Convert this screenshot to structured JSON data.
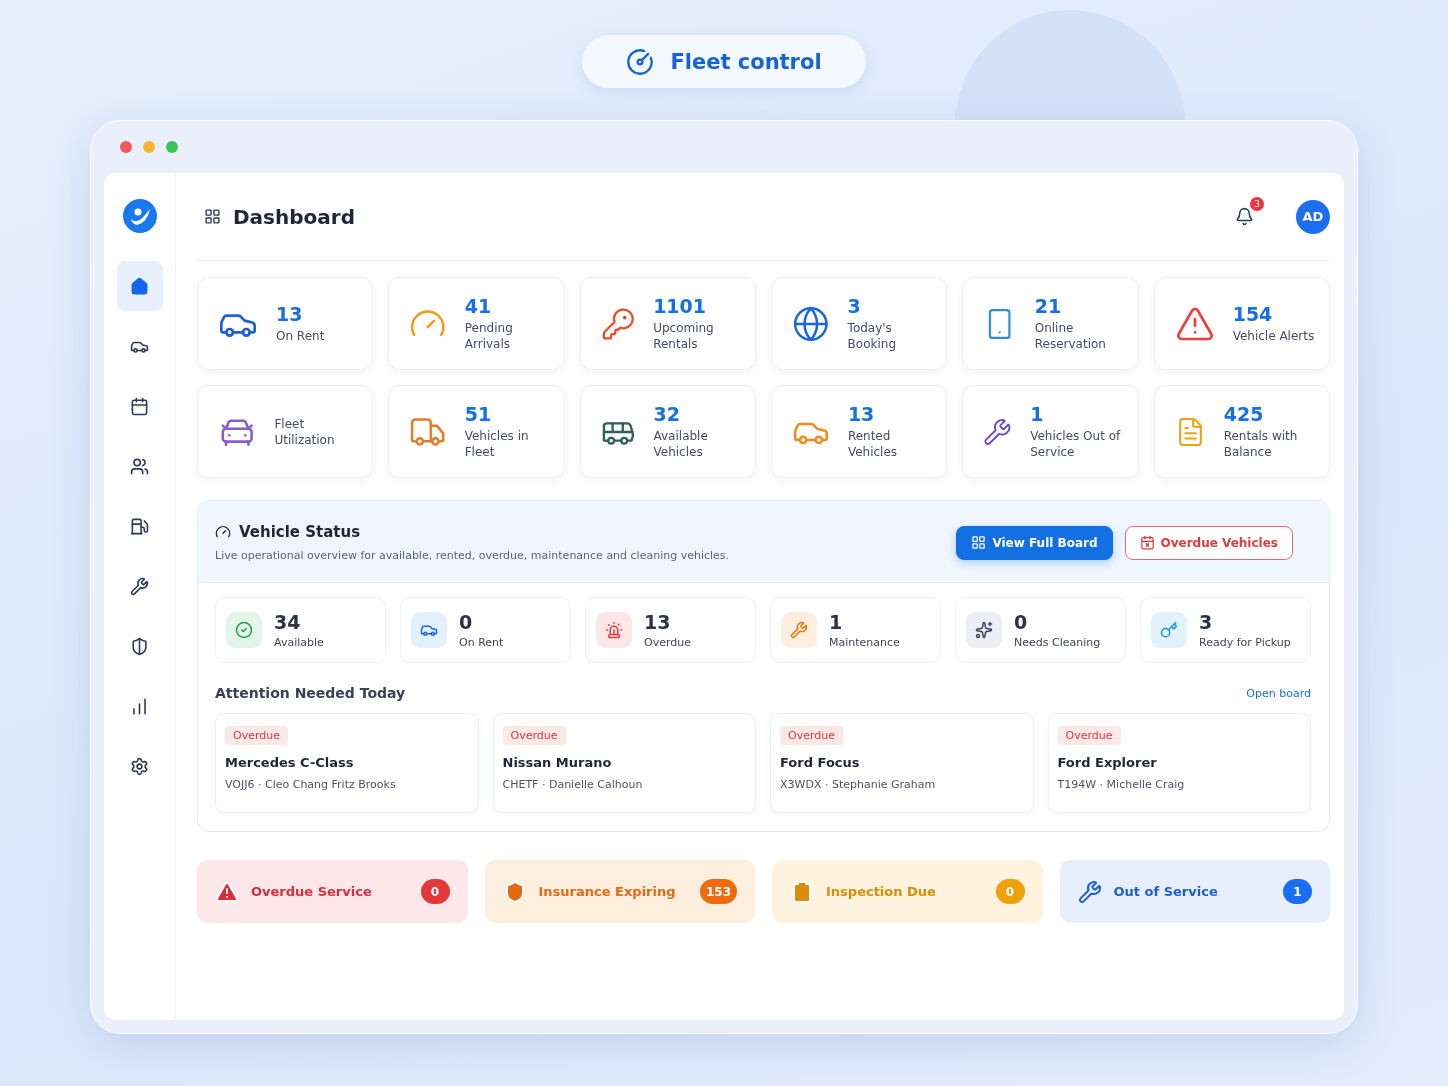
{
  "app_title": "Fleet control",
  "sidebar": {
    "items": [
      {
        "selected": true
      },
      {
        "selected": false
      },
      {
        "selected": false
      },
      {
        "selected": false
      },
      {
        "selected": false
      },
      {
        "selected": false
      },
      {
        "selected": false
      },
      {
        "selected": false
      },
      {
        "selected": false
      }
    ]
  },
  "header": {
    "title": "Dashboard",
    "notification_count": "3",
    "avatar": "AD"
  },
  "stats": [
    {
      "value": "13",
      "label": "On Rent"
    },
    {
      "value": "41",
      "label": "Pending Arrivals"
    },
    {
      "value": "1101",
      "label": "Upcoming Rentals"
    },
    {
      "value": "3",
      "label": "Today's Booking"
    },
    {
      "value": "21",
      "label": "Online Reservation"
    },
    {
      "value": "154",
      "label": "Vehicle Alerts"
    },
    {
      "label": "Fleet Utilization"
    },
    {
      "value": "51",
      "label": "Vehicles in Fleet"
    },
    {
      "value": "32",
      "label": "Available Vehicles"
    },
    {
      "value": "13",
      "label": "Rented Vehicles"
    },
    {
      "value": "1",
      "label": "Vehicles Out of Service"
    },
    {
      "value": "425",
      "label": "Rentals with Balance"
    }
  ],
  "vehicle_status": {
    "title": "Vehicle Status",
    "description": "Live operational overview for available, rented, overdue, maintenance and cleaning vehicles.",
    "buttons": [
      {
        "label": "View Full Board",
        "kind": "primary"
      },
      {
        "label": "Overdue Vehicles",
        "kind": "outline"
      }
    ],
    "counts": [
      {
        "value": "34",
        "label": "Available",
        "kind": "available"
      },
      {
        "value": "0",
        "label": "On Rent",
        "kind": "rent"
      },
      {
        "value": "13",
        "label": "Overdue",
        "kind": "overdue"
      },
      {
        "value": "1",
        "label": "Maintenance",
        "kind": "maintenance"
      },
      {
        "value": "0",
        "label": "Needs Cleaning",
        "kind": "cleaning"
      },
      {
        "value": "3",
        "label": "Ready for Pickup",
        "kind": "pickup"
      }
    ],
    "attention_title": "Attention Needed Today",
    "open_board": "Open board",
    "attention": [
      {
        "badge": "Overdue",
        "vehicle": "Mercedes C-Class",
        "detail": "VOJJ6 · Cleo Chang Fritz Brooks"
      },
      {
        "badge": "Overdue",
        "vehicle": "Nissan Murano",
        "detail": "CHETF · Danielle Calhoun"
      },
      {
        "badge": "Overdue",
        "vehicle": "Ford Focus",
        "detail": "X3WDX · Stephanie Graham"
      },
      {
        "badge": "Overdue",
        "vehicle": "Ford Explorer",
        "detail": "T194W · Michelle Craig"
      }
    ]
  },
  "alerts": [
    {
      "label": "Overdue Service",
      "count": "0",
      "kind": "danger"
    },
    {
      "label": "Insurance Expiring",
      "count": "153",
      "kind": "warning"
    },
    {
      "label": "Inspection Due",
      "count": "0",
      "kind": "caution"
    },
    {
      "label": "Out of Service",
      "count": "1",
      "kind": "info"
    }
  ]
}
